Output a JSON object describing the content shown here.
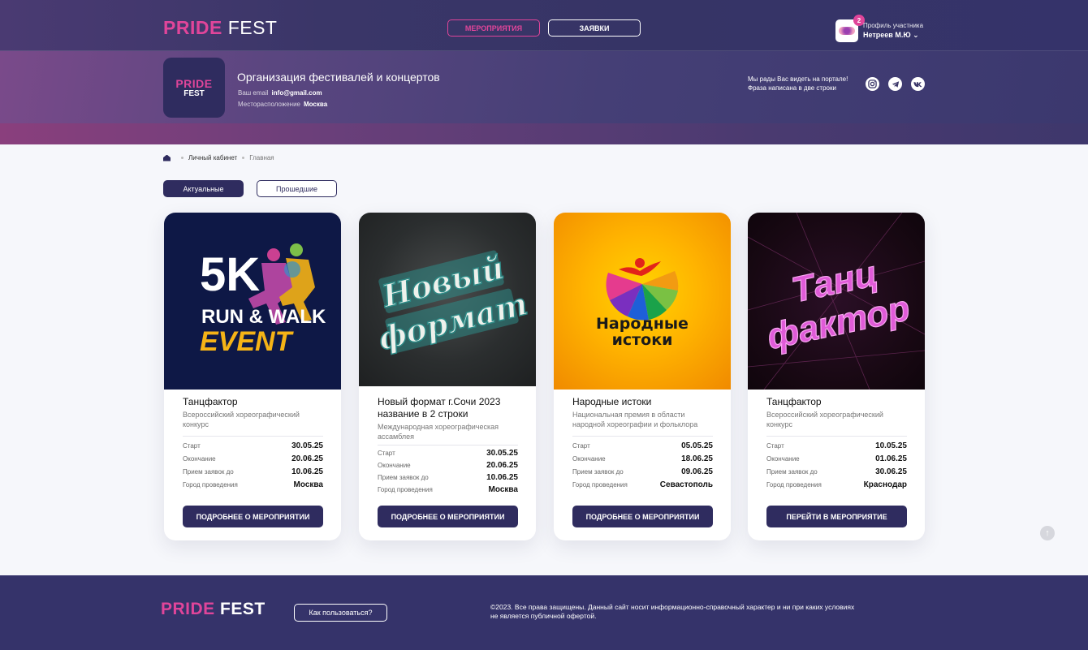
{
  "header": {
    "logo": {
      "pride": "PRIDE",
      "fest": "FEST"
    },
    "nav": {
      "events_label": "Мероприятия",
      "applications_label": "Заявки"
    },
    "profile": {
      "caption": "Профиль участника",
      "name": "Нетреев М.Ю",
      "notifications": "2"
    }
  },
  "organization": {
    "logo_pride": "PRIDE",
    "logo_fest": "FEST",
    "title": "Организация фестивалей и концертов",
    "email_label": "Ваш email",
    "email": "info@gmail.com",
    "location_label": "Месторасположение",
    "location": "Москва",
    "welcome_line1": "Мы рады Вас видеть на портале!",
    "welcome_line2": "Фраза написана в две строки",
    "socials": [
      "instagram-icon",
      "telegram-icon",
      "vk-icon"
    ]
  },
  "breadcrumbs": {
    "item1": "Личный кабинет",
    "item2": "Главная"
  },
  "tabs": {
    "active": "Актуальные",
    "past": "Прошедшие"
  },
  "card_labels": {
    "start": "Старт",
    "end": "Окончание",
    "deadline": "Прием заявок до",
    "city": "Город проведения"
  },
  "cards": [
    {
      "title": "Танцфактор",
      "subtitle": "Всероссийский хореографический конкурс",
      "start": "30.05.25",
      "end": "20.06.25",
      "deadline": "10.06.25",
      "city": "Москва",
      "button": "Подробнее о мероприятии",
      "image_text": {
        "line1": "5K",
        "line2": "RUN & WALK",
        "line3": "EVENT"
      }
    },
    {
      "title": "Новый формат г.Сочи 2023 название в 2 строки",
      "subtitle": "Международная хореографическая ассамблея",
      "start": "30.05.25",
      "end": "20.06.25",
      "deadline": "10.06.25",
      "city": "Москва",
      "button": "Подробнее о мероприятии",
      "image_text": {
        "line1": "Новый",
        "line2": "формат"
      }
    },
    {
      "title": "Народные истоки",
      "subtitle": "Национальная премия в области народной хореографии и фольклора",
      "start": "05.05.25",
      "end": "18.06.25",
      "deadline": "09.06.25",
      "city": "Севастополь",
      "button": "Подробнее о мероприятии",
      "image_text": {
        "line1": "Народные",
        "line2": "истоки"
      }
    },
    {
      "title": "Танцфактор",
      "subtitle": "Всероссийский хореографический конкурс",
      "start": "10.05.25",
      "end": "01.06.25",
      "deadline": "30.06.25",
      "city": "Краснодар",
      "button": "Перейти в мероприятие",
      "image_text": {
        "line1": "Танц",
        "line2": "фактор"
      }
    }
  ],
  "footer": {
    "logo_pride": "PRIDE",
    "logo_fest": "FEST",
    "how_to_use": "Как пользоваться?",
    "copyright_line1": "©2023. Все права защищены. Данный сайт носит информационно-справочный характер и ни при каких условиях",
    "copyright_line2": "не является публичной офертой."
  },
  "colors": {
    "brand_dark": "#2f2c5f",
    "accent_pink": "#e0459a",
    "header_bg": "#35336a"
  }
}
